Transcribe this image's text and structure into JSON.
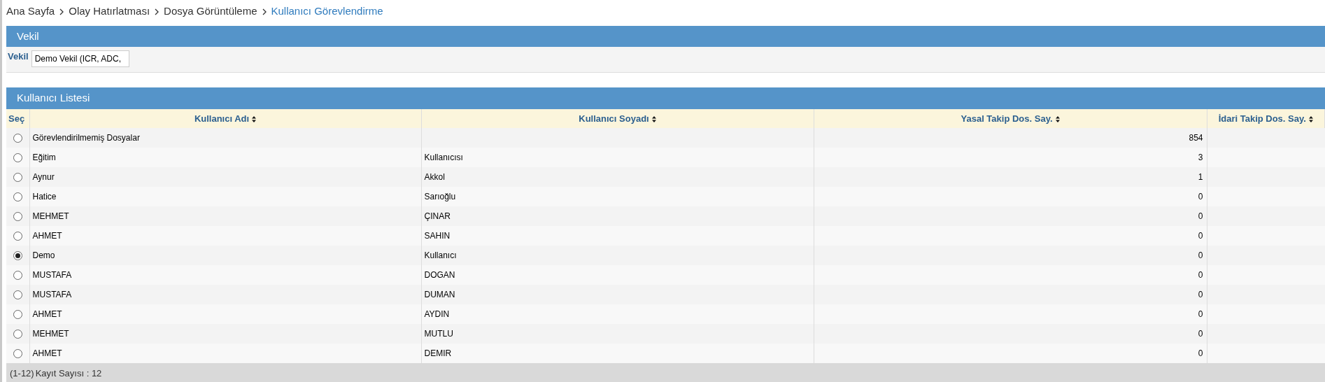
{
  "breadcrumb": [
    {
      "label": "Ana Sayfa",
      "selected": false
    },
    {
      "label": "Olay Hatırlatması",
      "selected": false
    },
    {
      "label": "Dosya Görüntüleme",
      "selected": false
    },
    {
      "label": "Kullanıcı Görevlendirme",
      "selected": true
    }
  ],
  "vekil_panel": {
    "title": "Vekil",
    "field_label": "Vekil",
    "field_value": "Demo Vekil (ICR, ADC,"
  },
  "user_list": {
    "title": "Kullanıcı Listesi",
    "columns": [
      "Seç",
      "Kullanıcı Adı",
      "Kullanıcı Soyadı",
      "Yasal Takip Dos. Say.",
      "İdari Takip Dos. Say."
    ],
    "rows": [
      {
        "selected": false,
        "name": "Görevlendirilmemiş Dosyalar",
        "surname": "",
        "legal_count": "854"
      },
      {
        "selected": false,
        "name": "Eğitim",
        "surname": "Kullanıcısı",
        "legal_count": "3"
      },
      {
        "selected": false,
        "name": "Aynur",
        "surname": "Akkol",
        "legal_count": "1"
      },
      {
        "selected": false,
        "name": "Hatice",
        "surname": "Sarıoğlu",
        "legal_count": "0"
      },
      {
        "selected": false,
        "name": "MEHMET",
        "surname": "ÇINAR",
        "legal_count": "0"
      },
      {
        "selected": false,
        "name": "AHMET",
        "surname": "SAHIN",
        "legal_count": "0"
      },
      {
        "selected": true,
        "name": "Demo",
        "surname": "Kullanıcı",
        "legal_count": "0"
      },
      {
        "selected": false,
        "name": "MUSTAFA",
        "surname": "DOGAN",
        "legal_count": "0"
      },
      {
        "selected": false,
        "name": "MUSTAFA",
        "surname": "DUMAN",
        "legal_count": "0"
      },
      {
        "selected": false,
        "name": "AHMET",
        "surname": "AYDIN",
        "legal_count": "0"
      },
      {
        "selected": false,
        "name": "MEHMET",
        "surname": "MUTLU",
        "legal_count": "0"
      },
      {
        "selected": false,
        "name": "AHMET",
        "surname": "DEMIR",
        "legal_count": "0"
      }
    ],
    "footer": {
      "range": "(1-12)",
      "count_text": "Kayıt Sayısı : 12"
    }
  }
}
